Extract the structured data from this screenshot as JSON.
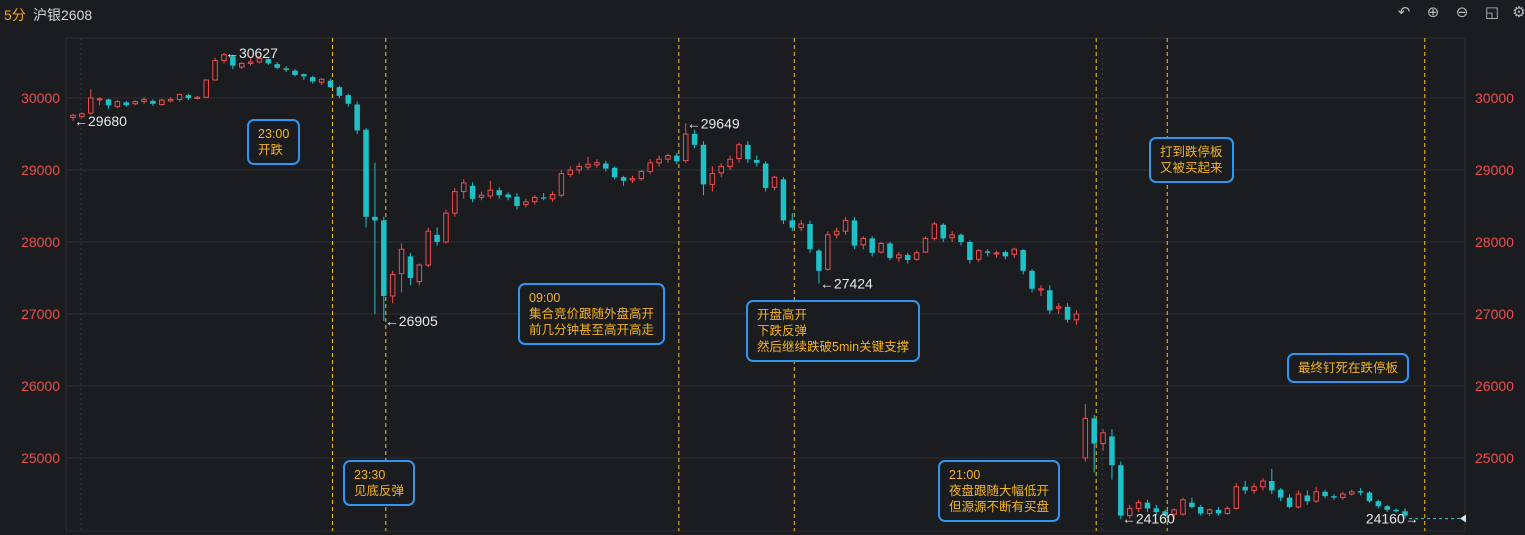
{
  "header": {
    "timeframe": "5分",
    "symbol": "沪银2608",
    "tools": [
      "undo-icon",
      "zoom-in-icon",
      "zoom-out-icon",
      "layout-icon",
      "settings-icon"
    ]
  },
  "colors": {
    "background": "#1b1c20",
    "up": "#ef4d4d",
    "down": "#1ec1c8",
    "axis_label": "#ef4d4d",
    "annotation_border": "#2f96f0",
    "annotation_text": "#f5b31f",
    "marker_line": "#f5c518"
  },
  "chart_data": {
    "type": "candlestick",
    "title": "",
    "xlabel": "",
    "ylabel": "",
    "ylim": [
      24000,
      30800
    ],
    "y_ticks": [
      25000,
      26000,
      27000,
      28000,
      29000,
      30000
    ],
    "grid": true,
    "left_axis_labels": true,
    "right_axis_labels": true,
    "candles": [
      [
        29730,
        29760,
        29680,
        29780
      ],
      [
        29740,
        29780,
        29720,
        29800
      ],
      [
        29790,
        30000,
        29770,
        30120
      ],
      [
        29990,
        29990,
        29900,
        30010
      ],
      [
        29980,
        29900,
        29850,
        29990
      ],
      [
        29880,
        29950,
        29860,
        29970
      ],
      [
        29940,
        29900,
        29880,
        29960
      ],
      [
        29920,
        29950,
        29900,
        29970
      ],
      [
        29950,
        29980,
        29920,
        30010
      ],
      [
        29960,
        29920,
        29890,
        29980
      ],
      [
        29910,
        29970,
        29890,
        29990
      ],
      [
        29960,
        29980,
        29940,
        30010
      ],
      [
        29980,
        30050,
        29950,
        30060
      ],
      [
        30040,
        30000,
        29970,
        30060
      ],
      [
        30000,
        30010,
        29980,
        30030
      ],
      [
        30010,
        30250,
        30000,
        30260
      ],
      [
        30250,
        30520,
        30240,
        30560
      ],
      [
        30520,
        30600,
        30480,
        30627
      ],
      [
        30580,
        30450,
        30400,
        30600
      ],
      [
        30430,
        30480,
        30400,
        30500
      ],
      [
        30480,
        30500,
        30450,
        30560
      ],
      [
        30500,
        30550,
        30480,
        30570
      ],
      [
        30540,
        30480,
        30460,
        30560
      ],
      [
        30470,
        30420,
        30400,
        30500
      ],
      [
        30410,
        30390,
        30360,
        30440
      ],
      [
        30380,
        30320,
        30300,
        30400
      ],
      [
        30330,
        30300,
        30250,
        30340
      ],
      [
        30290,
        30230,
        30200,
        30310
      ],
      [
        30220,
        30260,
        30180,
        30280
      ],
      [
        30240,
        30150,
        30140,
        30270
      ],
      [
        30150,
        30030,
        30000,
        30170
      ],
      [
        30040,
        29920,
        29880,
        30060
      ],
      [
        29910,
        29550,
        29500,
        29950
      ],
      [
        29560,
        28350,
        28200,
        29580
      ],
      [
        28350,
        28300,
        27000,
        29100
      ],
      [
        28300,
        27250,
        26905,
        28350
      ],
      [
        27250,
        27550,
        27150,
        27600
      ],
      [
        27560,
        27900,
        27300,
        27980
      ],
      [
        27800,
        27500,
        27400,
        27850
      ],
      [
        27450,
        27680,
        27400,
        27700
      ],
      [
        27680,
        28150,
        27650,
        28200
      ],
      [
        28100,
        28000,
        27950,
        28200
      ],
      [
        28000,
        28400,
        27980,
        28450
      ],
      [
        28400,
        28700,
        28350,
        28750
      ],
      [
        28700,
        28820,
        28600,
        28870
      ],
      [
        28780,
        28600,
        28550,
        28830
      ],
      [
        28620,
        28650,
        28580,
        28700
      ],
      [
        28640,
        28720,
        28600,
        28850
      ],
      [
        28720,
        28650,
        28600,
        28760
      ],
      [
        28660,
        28620,
        28580,
        28690
      ],
      [
        28630,
        28500,
        28450,
        28680
      ],
      [
        28520,
        28560,
        28480,
        28600
      ],
      [
        28560,
        28620,
        28520,
        28650
      ],
      [
        28620,
        28610,
        28580,
        28680
      ],
      [
        28600,
        28660,
        28560,
        28700
      ],
      [
        28650,
        28950,
        28620,
        29000
      ],
      [
        28940,
        29000,
        28900,
        29050
      ],
      [
        29000,
        29050,
        28950,
        29100
      ],
      [
        29040,
        29080,
        29000,
        29180
      ],
      [
        29070,
        29100,
        29030,
        29150
      ],
      [
        29090,
        29020,
        28980,
        29130
      ],
      [
        29030,
        28900,
        28870,
        29050
      ],
      [
        28900,
        28850,
        28780,
        28920
      ],
      [
        28860,
        28880,
        28820,
        28920
      ],
      [
        28880,
        28980,
        28850,
        29000
      ],
      [
        28980,
        29100,
        28940,
        29150
      ],
      [
        29100,
        29150,
        29050,
        29200
      ],
      [
        29150,
        29200,
        29100,
        29230
      ],
      [
        29200,
        29120,
        29080,
        29240
      ],
      [
        29130,
        29500,
        29100,
        29649
      ],
      [
        29500,
        29350,
        29300,
        29560
      ],
      [
        29350,
        28800,
        28650,
        29400
      ],
      [
        28800,
        28950,
        28700,
        29050
      ],
      [
        28960,
        29050,
        28900,
        29100
      ],
      [
        29050,
        29150,
        29000,
        29200
      ],
      [
        29160,
        29350,
        29100,
        29380
      ],
      [
        29350,
        29150,
        29100,
        29400
      ],
      [
        29140,
        29100,
        29050,
        29200
      ],
      [
        29090,
        28750,
        28700,
        29120
      ],
      [
        28760,
        28900,
        28720,
        28920
      ],
      [
        28870,
        28300,
        28250,
        28900
      ],
      [
        28300,
        28200,
        28150,
        28400
      ],
      [
        28200,
        28250,
        28150,
        28300
      ],
      [
        28250,
        27900,
        27850,
        28300
      ],
      [
        27880,
        27600,
        27424,
        27900
      ],
      [
        27620,
        28100,
        27600,
        28150
      ],
      [
        28100,
        28150,
        28050,
        28200
      ],
      [
        28150,
        28300,
        28100,
        28350
      ],
      [
        28300,
        27950,
        27900,
        28350
      ],
      [
        27960,
        28050,
        27900,
        28080
      ],
      [
        28050,
        27850,
        27800,
        28080
      ],
      [
        27860,
        27980,
        27840,
        28000
      ],
      [
        27980,
        27780,
        27750,
        28000
      ],
      [
        27780,
        27820,
        27720,
        27860
      ],
      [
        27820,
        27750,
        27700,
        27850
      ],
      [
        27760,
        27850,
        27740,
        27880
      ],
      [
        27860,
        28050,
        27850,
        28080
      ],
      [
        28050,
        28250,
        28020,
        28280
      ],
      [
        28240,
        28050,
        28000,
        28260
      ],
      [
        28060,
        28100,
        28000,
        28150
      ],
      [
        28100,
        28000,
        27950,
        28120
      ],
      [
        28000,
        27750,
        27700,
        28020
      ],
      [
        27760,
        27880,
        27720,
        27900
      ],
      [
        27870,
        27850,
        27800,
        27900
      ],
      [
        27850,
        27850,
        27780,
        27880
      ],
      [
        27860,
        27800,
        27760,
        27880
      ],
      [
        27830,
        27900,
        27780,
        27920
      ],
      [
        27890,
        27600,
        27550,
        27900
      ],
      [
        27600,
        27350,
        27300,
        27620
      ],
      [
        27350,
        27350,
        27250,
        27400
      ],
      [
        27330,
        27050,
        27000,
        27400
      ],
      [
        27080,
        27100,
        27000,
        27150
      ],
      [
        27100,
        26920,
        26880,
        27150
      ],
      [
        26920,
        27000,
        26850,
        27050
      ],
      [
        25000,
        25550,
        24950,
        25750
      ],
      [
        25550,
        25200,
        24800,
        25600
      ],
      [
        25200,
        25350,
        25100,
        25400
      ],
      [
        25300,
        24900,
        24700,
        25400
      ],
      [
        24900,
        24200,
        24150,
        24950
      ],
      [
        24200,
        24300,
        24160,
        24350
      ],
      [
        24300,
        24380,
        24250,
        24420
      ],
      [
        24380,
        24300,
        24250,
        24420
      ],
      [
        24300,
        24250,
        24200,
        24350
      ],
      [
        24260,
        24210,
        24180,
        24280
      ],
      [
        24220,
        24280,
        24160,
        24300
      ],
      [
        24220,
        24420,
        24200,
        24450
      ],
      [
        24380,
        24320,
        24300,
        24450
      ],
      [
        24320,
        24230,
        24200,
        24350
      ],
      [
        24230,
        24280,
        24200,
        24300
      ],
      [
        24280,
        24230,
        24200,
        24320
      ],
      [
        24230,
        24300,
        24210,
        24330
      ],
      [
        24300,
        24600,
        24280,
        24650
      ],
      [
        24600,
        24550,
        24500,
        24680
      ],
      [
        24550,
        24600,
        24500,
        24650
      ],
      [
        24600,
        24680,
        24550,
        24720
      ],
      [
        24680,
        24550,
        24500,
        24850
      ],
      [
        24560,
        24450,
        24400,
        24580
      ],
      [
        24450,
        24320,
        24300,
        24500
      ],
      [
        24320,
        24500,
        24300,
        24550
      ],
      [
        24480,
        24400,
        24350,
        24550
      ],
      [
        24400,
        24530,
        24380,
        24600
      ],
      [
        24530,
        24470,
        24440,
        24560
      ],
      [
        24470,
        24450,
        24420,
        24500
      ],
      [
        24450,
        24500,
        24420,
        24530
      ],
      [
        24500,
        24530,
        24480,
        24560
      ],
      [
        24540,
        24520,
        24480,
        24580
      ],
      [
        24520,
        24400,
        24380,
        24540
      ],
      [
        24400,
        24330,
        24300,
        24420
      ],
      [
        24330,
        24280,
        24250,
        24350
      ],
      [
        24280,
        24260,
        24240,
        24300
      ],
      [
        24260,
        24200,
        24160,
        24300
      ]
    ],
    "limit_down_line": 24160,
    "price_labels": [
      {
        "text": "←29680",
        "price": 29680,
        "index": 0
      },
      {
        "text": "←30627",
        "price": 30627,
        "index": 17
      },
      {
        "text": "←26905",
        "price": 26905,
        "index": 35
      },
      {
        "text": "←29649",
        "price": 29649,
        "index": 69
      },
      {
        "text": "←27424",
        "price": 27424,
        "index": 84
      },
      {
        "text": "←24160",
        "price": 24160,
        "index": 118
      },
      {
        "text": "24160→",
        "price": 24160,
        "index": 152
      }
    ],
    "marker_lines_at_index": [
      29,
      35,
      68,
      81,
      115,
      123,
      152
    ],
    "annotations": [
      {
        "lines": [
          "23:00",
          "开跌"
        ]
      },
      {
        "lines": [
          "23:30",
          "见底反弹"
        ]
      },
      {
        "lines": [
          "09:00",
          "集合竞价跟随外盘高开",
          "前几分钟甚至高开高走"
        ]
      },
      {
        "lines": [
          "开盘高开",
          "下跌反弹",
          "然后继续跌破5min关键支撑"
        ]
      },
      {
        "lines": [
          "21:00",
          "夜盘跟随大幅低开",
          "但源源不断有买盘"
        ]
      },
      {
        "lines": [
          "打到跌停板",
          "又被买起来"
        ]
      },
      {
        "lines": [
          "最终钉死在跌停板"
        ]
      }
    ]
  }
}
